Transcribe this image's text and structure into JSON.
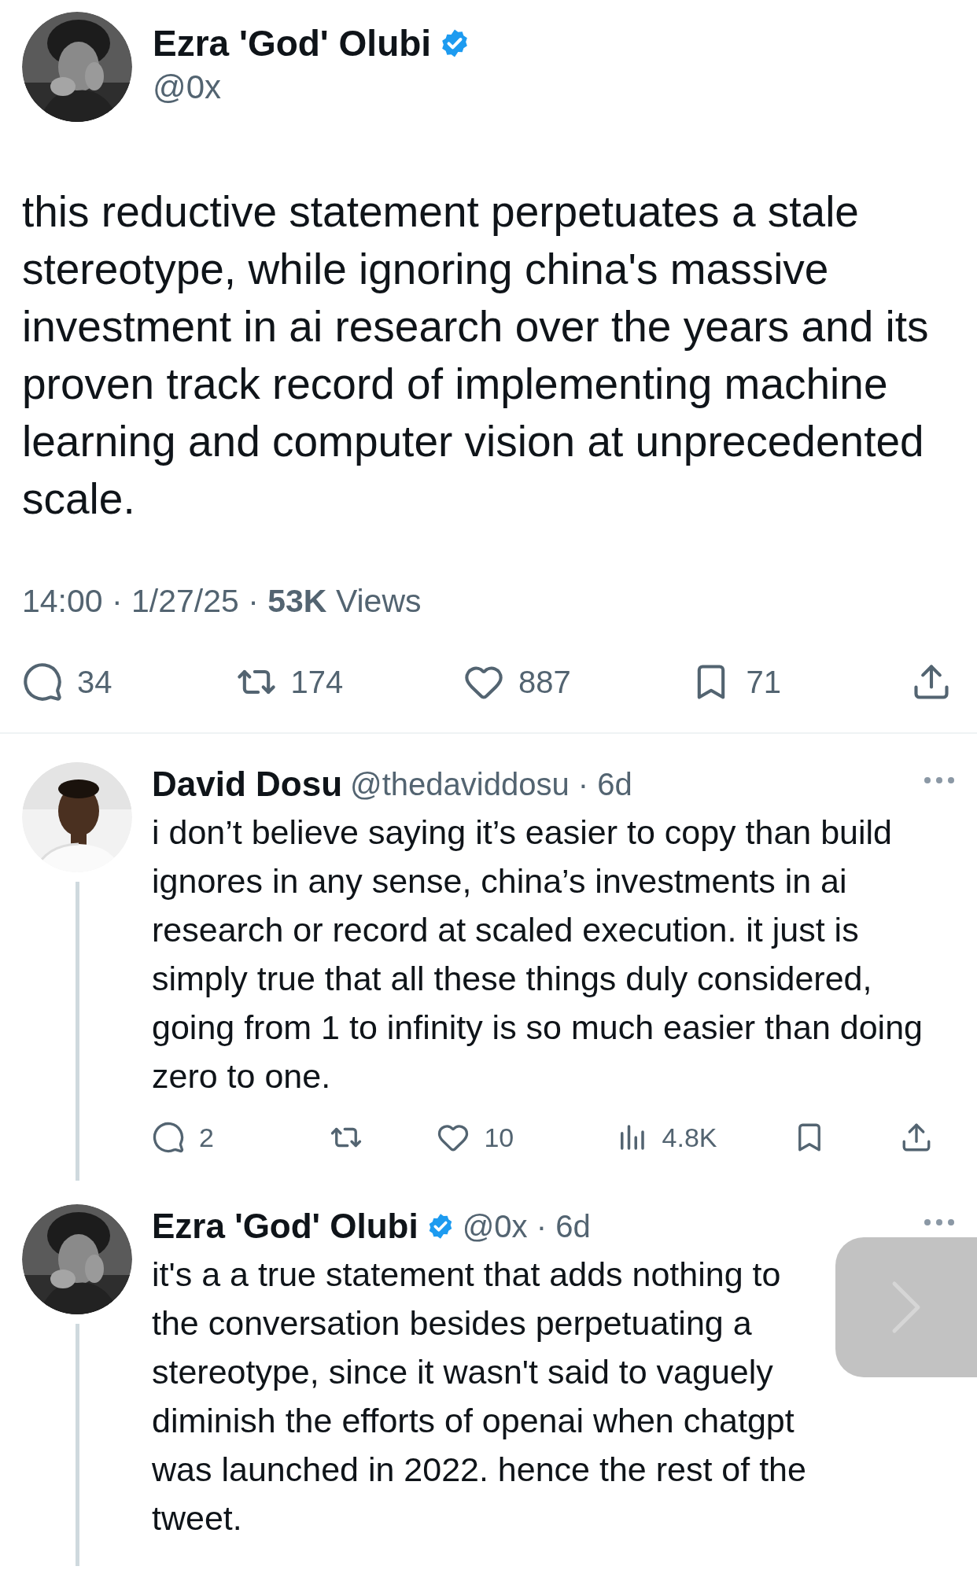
{
  "main_tweet": {
    "author": {
      "name": "Ezra 'God' Olubi",
      "handle": "@0x",
      "verified": true
    },
    "text": "this reductive statement perpetuates a stale stereotype, while ignoring china's massive investment in ai research over the years and its proven track record of implementing machine learning and computer vision at unprecedented scale.",
    "meta": "14:00 · 1/27/25 · **53K** Views",
    "actions": [
      {
        "kind": "reply",
        "count": "34"
      },
      {
        "kind": "repost",
        "count": "174"
      },
      {
        "kind": "like",
        "count": "887"
      },
      {
        "kind": "bookmark",
        "count": "71"
      },
      {
        "kind": "share"
      }
    ]
  },
  "replies": [
    {
      "author": {
        "name": "David Dosu",
        "verified": false
      },
      "meta": "@thedaviddosu · 6d",
      "text": "i don’t believe saying it’s easier to copy than build ignores in any sense, china’s investments in ai research or record at scaled execution. it just is simply true that all these things duly considered, going from 1 to infinity is so much easier than doing zero to one.",
      "actions": [
        {
          "kind": "reply",
          "count": "2"
        },
        {
          "kind": "repost"
        },
        {
          "kind": "like",
          "count": "10"
        },
        {
          "kind": "views",
          "count": "4.8K"
        },
        {
          "kind": "bookmark"
        },
        {
          "kind": "share"
        }
      ]
    },
    {
      "author": {
        "name": "Ezra 'God' Olubi",
        "verified": true
      },
      "meta": "@0x · 6d",
      "text": "it's a a true statement that adds nothing to the conversation besides perpetuating a stereotype, since it wasn't said to vaguely diminish the efforts of openai when chatgpt was launched in 2022. hence the rest of the tweet."
    }
  ]
}
